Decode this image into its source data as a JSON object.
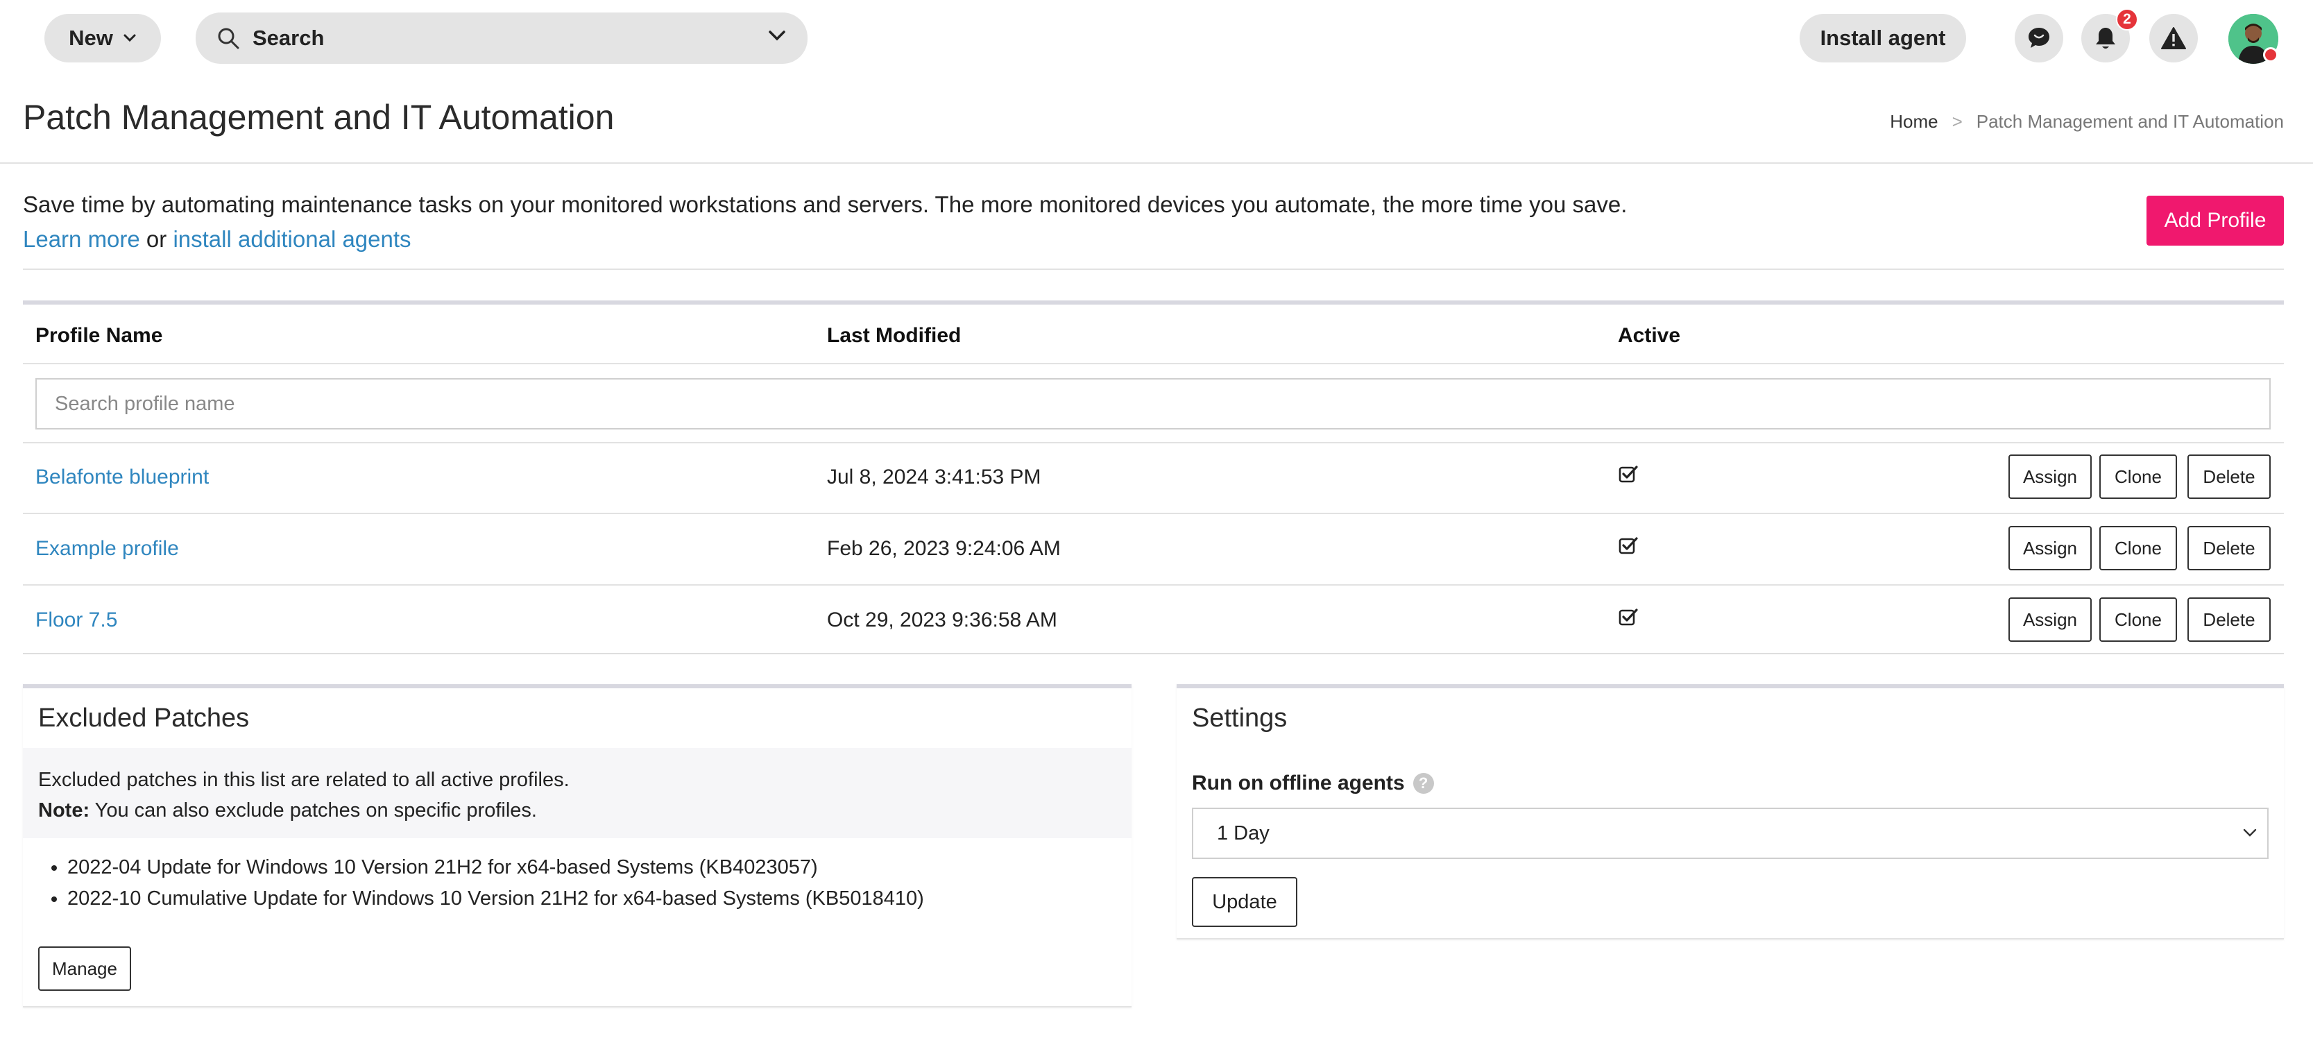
{
  "topbar": {
    "new_label": "New",
    "search_label": "Search",
    "install_agent_label": "Install agent",
    "notification_count": "2"
  },
  "header": {
    "title": "Patch Management and IT Automation",
    "breadcrumb": {
      "home": "Home",
      "separator": ">",
      "current": "Patch Management and IT Automation"
    }
  },
  "intro": {
    "text": "Save time by automating maintenance tasks on your monitored workstations and servers. The more monitored devices you automate, the more time you save.",
    "learn_more": "Learn more",
    "or": " or ",
    "install_additional": "install additional agents",
    "add_profile_label": "Add Profile"
  },
  "profiles_table": {
    "columns": [
      "Profile Name",
      "Last Modified",
      "Active"
    ],
    "search_placeholder": "Search profile name",
    "rows": [
      {
        "name": "Belafonte blueprint",
        "modified": "Jul 8, 2024 3:41:53 PM",
        "active": true
      },
      {
        "name": "Example profile",
        "modified": "Feb 26, 2023 9:24:06 AM",
        "active": true
      },
      {
        "name": "Floor 7.5",
        "modified": "Oct 29, 2023 9:36:58 AM",
        "active": true
      }
    ],
    "actions": {
      "assign": "Assign",
      "clone": "Clone",
      "delete": "Delete"
    }
  },
  "excluded_patches": {
    "title": "Excluded Patches",
    "description": "Excluded patches in this list are related to all active profiles.",
    "note_label": "Note:",
    "note_text": " You can also exclude patches on specific profiles.",
    "patches": [
      "2022-04 Update for Windows 10 Version 21H2 for x64-based Systems (KB4023057)",
      "2022-10 Cumulative Update for Windows 10 Version 21H2 for x64-based Systems (KB5018410)"
    ],
    "manage_label": "Manage"
  },
  "settings": {
    "title": "Settings",
    "run_offline_label": "Run on offline agents",
    "help_glyph": "?",
    "selected_value": "1 Day",
    "update_label": "Update"
  },
  "colors": {
    "accent": "#f0186e",
    "link": "#2f86bf",
    "badge": "#e5343a",
    "avatar_bg": "#4fc38a"
  }
}
